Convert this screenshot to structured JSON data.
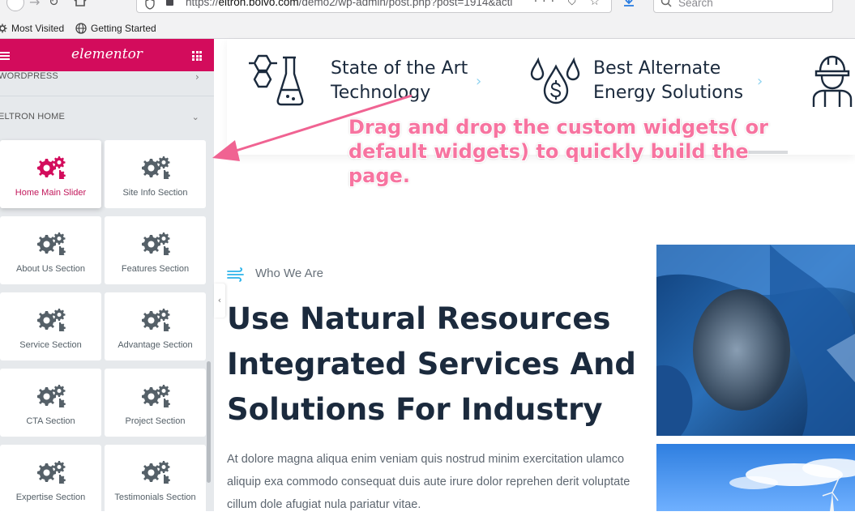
{
  "browser": {
    "url_prefix": "https://",
    "url_domain": "eltron.bolvo.com",
    "url_path": "/demo2/wp-admin/post.php?post=1914&acti",
    "url_icons": "··· ⛉ ☆",
    "search_placeholder": "Search",
    "bookmarks": [
      {
        "label": "Most Visited",
        "icon": "gear-icon"
      },
      {
        "label": "Getting Started",
        "icon": "globe-icon"
      }
    ]
  },
  "panel": {
    "logo": "elementor",
    "categories": [
      {
        "label": "WORDPRESS",
        "state": "collapsed"
      },
      {
        "label": "ELTRON HOME",
        "state": "expanded"
      }
    ],
    "widgets": [
      {
        "label": "Home Main Slider",
        "active": true
      },
      {
        "label": "Site Info Section"
      },
      {
        "label": "About Us Section"
      },
      {
        "label": "Features Section"
      },
      {
        "label": "Service Section"
      },
      {
        "label": "Advantage Section"
      },
      {
        "label": "CTA Section"
      },
      {
        "label": "Project Section"
      },
      {
        "label": "Expertise Section"
      },
      {
        "label": "Testimonials Section"
      }
    ],
    "accent_color": "#d30c5c"
  },
  "page": {
    "features": [
      {
        "line1": "State of the Art",
        "line2": "Technology",
        "icon": "lab-flask-icon"
      },
      {
        "line1": "Best Alternate",
        "line2": "Energy Solutions",
        "icon": "water-dollar-icon"
      },
      {
        "line1": "",
        "line2": "",
        "icon": "engineer-icon"
      }
    ],
    "who_label": "Who We Are",
    "headline": "Use Natural Resources Integrated Services And Solutions For Industry",
    "paragraph": "At dolore magna aliqua enim veniam quis nostrud minim exercitation ulamco aliquip exa commodo consequat duis aute irure dolor reprehen derit voluptate cillum dole afugiat nula pariatur vitae.",
    "text_color": "#1b2a3d",
    "icon_color": "#1b2a3d",
    "chevron_color": "#8fd3f0"
  },
  "annotation": {
    "text": "Drag and drop the custom widgets( or default widgets) to quickly build the page.",
    "color": "#f774a0"
  }
}
